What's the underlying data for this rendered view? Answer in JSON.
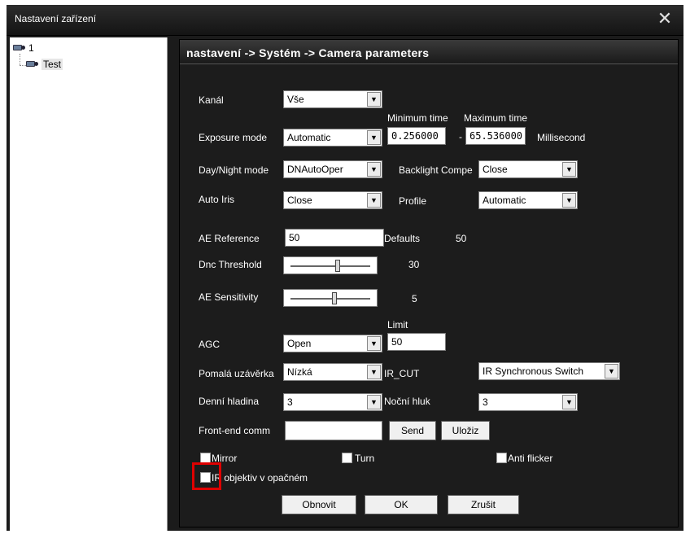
{
  "window": {
    "title": "Nastavení zařízení",
    "close_glyph": "✕"
  },
  "tree": {
    "root_label": "1",
    "child_label": "Test"
  },
  "header": {
    "breadcrumb": "nastavení -> Systém -> Camera parameters"
  },
  "form": {
    "channel": {
      "label": "Kanál",
      "value": "Vše"
    },
    "exposure": {
      "label": "Exposure mode",
      "value": "Automatic",
      "min_label": "Minimum time",
      "max_label": "Maximum time",
      "min_value": "0.256000",
      "max_value": "65.536000",
      "unit": "Millisecond",
      "dash": "-"
    },
    "day_night": {
      "label": "Day/Night mode",
      "value": "DNAutoOper"
    },
    "backlight": {
      "label": "Backlight Compe",
      "value": "Close"
    },
    "auto_iris": {
      "label": "Auto Iris",
      "value": "Close"
    },
    "profile": {
      "label": "Profile",
      "value": "Automatic"
    },
    "ae_reference": {
      "label": "AE Reference",
      "value": "50",
      "defaults_label": "Defaults",
      "defaults_value": "50"
    },
    "dnc_threshold": {
      "label": "Dnc Threshold",
      "value": "30",
      "fraction": 0.6
    },
    "ae_sensitivity": {
      "label": "AE Sensitivity",
      "value": "5",
      "fraction": 0.55
    },
    "agc": {
      "label": "AGC",
      "value": "Open",
      "limit_label": "Limit",
      "limit_value": "50"
    },
    "slow_shutter": {
      "label": "Pomalá uzávěrka",
      "value": "Nízká"
    },
    "ir_cut": {
      "label": "IR_CUT",
      "value": "IR Synchronous Switch"
    },
    "day_level": {
      "label": "Denní hladina",
      "value": "3"
    },
    "night_noise": {
      "label": "Noční hluk",
      "value": "3"
    },
    "front_end": {
      "label": "Front-end comm",
      "value": "",
      "send_label": "Send",
      "save_label": "Uložiz"
    },
    "mirror": {
      "label": "Mirror",
      "checked": false
    },
    "turn": {
      "label": "Turn",
      "checked": false
    },
    "anti_flicker": {
      "label": "Anti flicker",
      "checked": false
    },
    "ir_reverse": {
      "label": "IR objektiv v opačném",
      "checked": false
    }
  },
  "buttons": {
    "refresh": "Obnovit",
    "ok": "OK",
    "cancel": "Zrušit"
  },
  "colors": {
    "panel_bg": "#1c1c1c",
    "highlight": "#e00000"
  }
}
